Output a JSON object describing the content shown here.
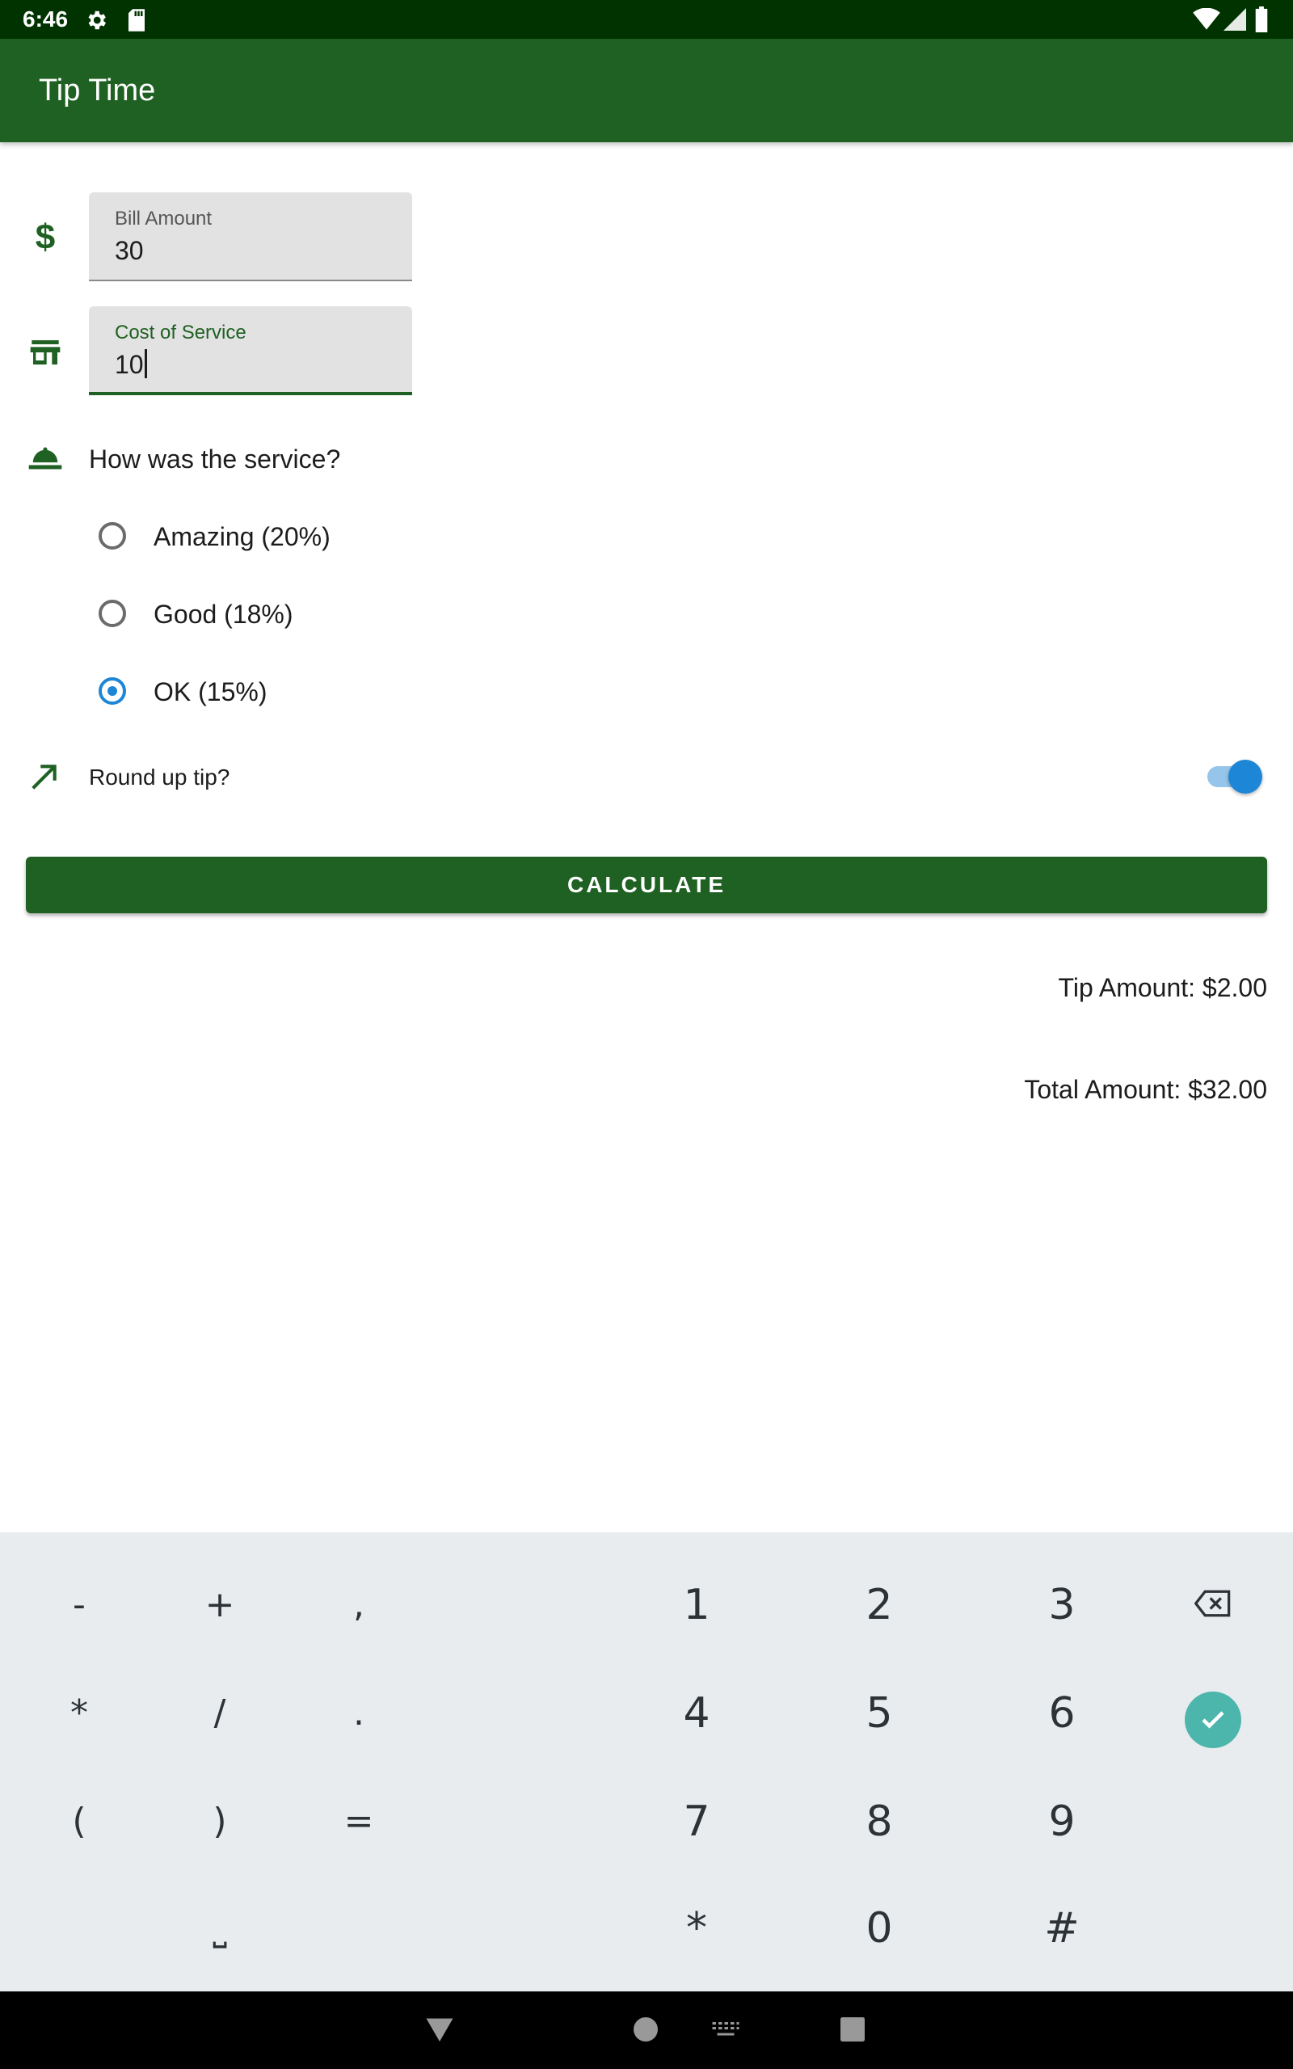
{
  "status_bar": {
    "time": "6:46",
    "icons": [
      "settings-icon",
      "sd-card-icon",
      "wifi-icon",
      "signal-icon",
      "battery-icon"
    ]
  },
  "app_bar": {
    "title": "Tip Time",
    "color": "#1f6122"
  },
  "bill_amount": {
    "label": "Bill Amount",
    "value": "30",
    "icon": "dollar-icon"
  },
  "cost_of_service": {
    "label": "Cost of Service",
    "value": "10",
    "icon": "storefront-icon"
  },
  "service": {
    "question": "How was the service?",
    "icon": "room-service-icon",
    "options": [
      {
        "label": "Amazing (20%)",
        "selected": false
      },
      {
        "label": "Good (18%)",
        "selected": false
      },
      {
        "label": "OK (15%)",
        "selected": true
      }
    ]
  },
  "round_up": {
    "label": "Round up tip?",
    "checked": true,
    "icon": "trending-up-icon"
  },
  "calculate": {
    "label": "CALCULATE"
  },
  "results": {
    "tip": "Tip Amount: $2.00",
    "total": "Total Amount: $32.00"
  },
  "keyboard": {
    "symbols": [
      [
        "-",
        "+",
        ","
      ],
      [
        "*",
        "/",
        "."
      ],
      [
        "(",
        ")",
        "="
      ],
      [
        "",
        "⎵",
        ""
      ]
    ],
    "digits": [
      [
        "1",
        "2",
        "3"
      ],
      [
        "4",
        "5",
        "6"
      ],
      [
        "7",
        "8",
        "9"
      ],
      [
        "*",
        "0",
        "#"
      ]
    ],
    "accent": "#4db6ac"
  },
  "accent_color": "#1e86d6"
}
